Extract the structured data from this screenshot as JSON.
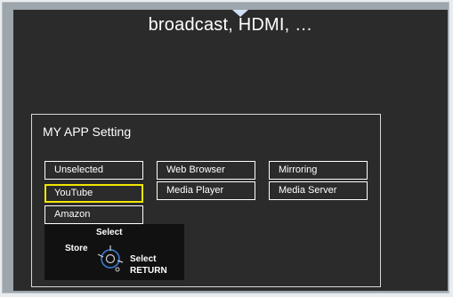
{
  "header": {
    "title": "broadcast, HDMI, …"
  },
  "panel": {
    "title": "MY APP Setting",
    "apps": [
      "Unselected",
      "YouTube",
      "Amazon",
      "Web Browser",
      "Media Player",
      "Mirroring",
      "Media Server"
    ],
    "selected_app": "YouTube"
  },
  "remote_guide": {
    "top_label": "Select",
    "left_label": "Store",
    "right_label": "Select",
    "return_label": "RETURN"
  },
  "colors": {
    "screen_background": "#2b2b2b",
    "selection_highlight": "#f2e600",
    "text": "#ffffff"
  }
}
